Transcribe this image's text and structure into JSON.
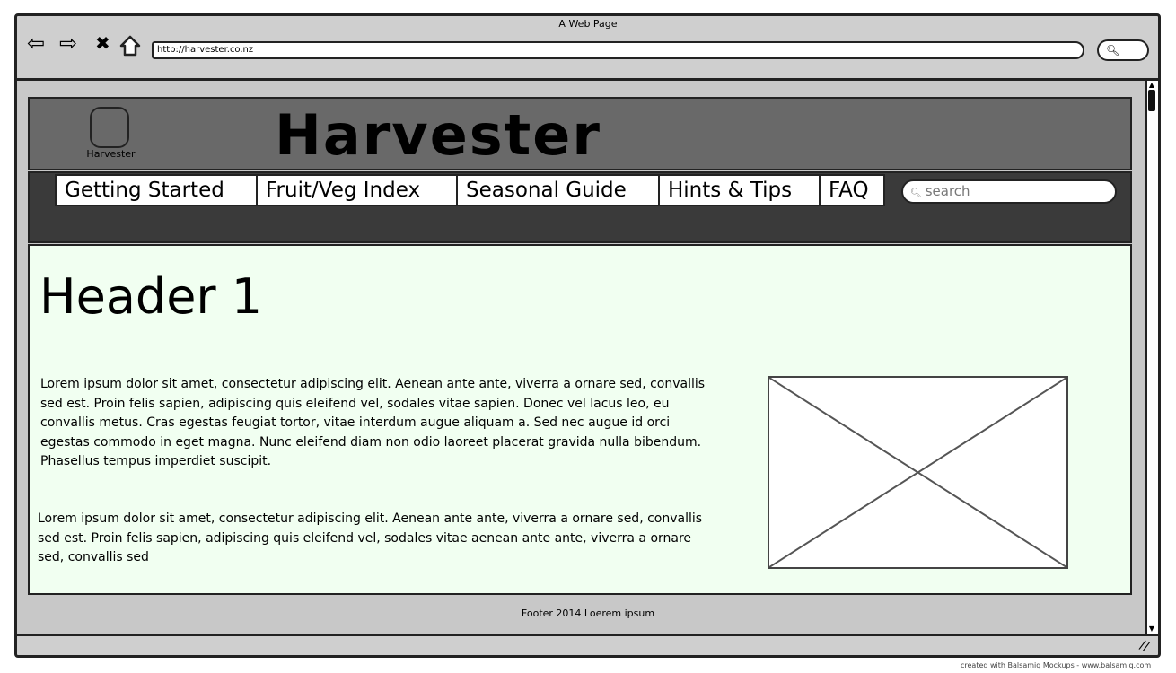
{
  "browser": {
    "window_title": "A Web Page",
    "url": "http://harvester.co.nz",
    "icons": [
      "back-arrow-icon",
      "forward-arrow-icon",
      "stop-icon",
      "home-icon",
      "search-icon"
    ]
  },
  "site": {
    "title": "Harvester",
    "logo_label": "Harvester",
    "nav": [
      {
        "label": "Getting Started"
      },
      {
        "label": "Fruit/Veg Index"
      },
      {
        "label": "Seasonal Guide"
      },
      {
        "label": "Hints & Tips"
      },
      {
        "label": "FAQ"
      }
    ],
    "search_placeholder": "search"
  },
  "main": {
    "heading": "Header 1",
    "paragraphs": [
      "Lorem ipsum dolor sit amet, consectetur adipiscing elit. Aenean ante ante, viverra a ornare sed, convallis sed est. Proin felis sapien, adipiscing quis eleifend vel, sodales vitae sapien. Donec vel lacus leo, eu convallis metus. Cras egestas feugiat tortor, vitae interdum augue aliquam a. Sed nec augue id orci egestas commodo in eget magna. Nunc eleifend diam non odio laoreet placerat gravida nulla bibendum. Phasellus tempus imperdiet suscipit.",
      "Lorem ipsum dolor sit amet, consectetur adipiscing elit. Aenean ante ante, viverra a ornare sed, convallis sed est. Proin felis sapien, adipiscing quis eleifend vel, sodales vitae aenean ante ante, viverra a ornare sed, convallis sed"
    ]
  },
  "footer": {
    "text": "Footer 2014 Loerem ipsum"
  },
  "credit": "created with Balsamiq Mockups - www.balsamiq.com"
}
